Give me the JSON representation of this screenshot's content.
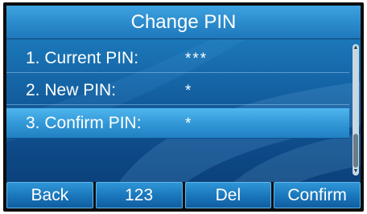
{
  "screen": {
    "title": "Change PIN"
  },
  "menu": {
    "items": [
      {
        "label": "1. Current PIN:",
        "value": "***"
      },
      {
        "label": "2. New PIN:",
        "value": "*"
      },
      {
        "label": "3. Confirm PIN:",
        "value": "*"
      }
    ],
    "selected_index": 2
  },
  "softkeys": [
    "Back",
    "123",
    "Del",
    "Confirm"
  ],
  "colors": {
    "title_bar": "#2a8acb",
    "background": "#176cae",
    "selection": "#3399d8",
    "softkey": "#1b78bd",
    "text": "#ffffff"
  }
}
